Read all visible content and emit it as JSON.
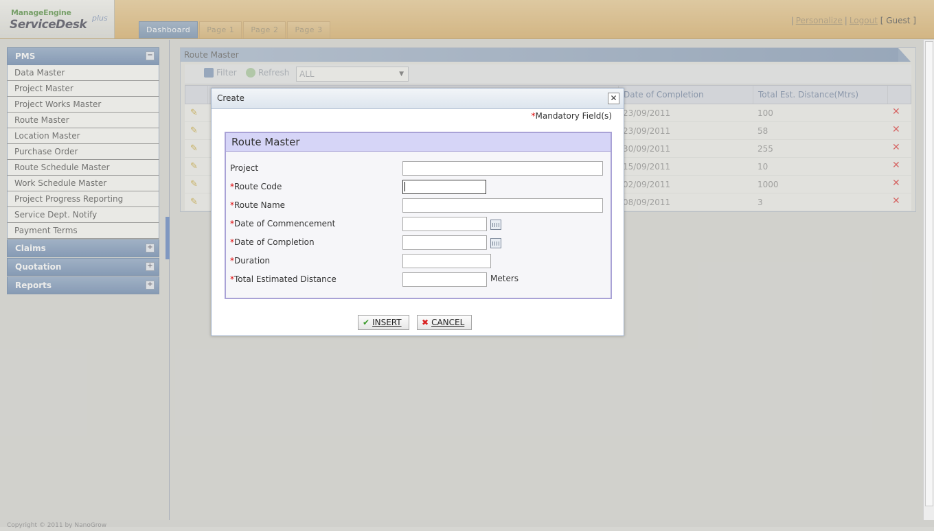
{
  "header": {
    "logo_top": "ManageEngine",
    "logo_main": "ServiceDesk",
    "logo_plus": "plus",
    "tabs": [
      "Dashboard",
      "Page 1",
      "Page 2",
      "Page 3"
    ],
    "personalize": "Personalize",
    "logout": "Logout",
    "user": "[ Guest ]"
  },
  "sidebar": {
    "pms": "PMS",
    "items": [
      "Data Master",
      "Project Master",
      "Project Works Master",
      "Route Master",
      "Location Master",
      "Purchase Order",
      "Route Schedule Master",
      "Work Schedule Master",
      "Project Progress Reporting",
      "Service Dept. Notify",
      "Payment Terms"
    ],
    "claims": "Claims",
    "quotation": "Quotation",
    "reports": "Reports"
  },
  "content": {
    "title": "Route Master",
    "filter": "Filter",
    "refresh": "Refresh",
    "select_value": "ALL",
    "col_completion": "Date of Completion",
    "col_distance": "Total Est. Distance(Mtrs)",
    "rows": [
      {
        "date": "23/09/2011",
        "dist": "100"
      },
      {
        "date": "23/09/2011",
        "dist": "58"
      },
      {
        "date": "30/09/2011",
        "dist": "255"
      },
      {
        "date": "15/09/2011",
        "dist": "10"
      },
      {
        "date": "02/09/2011",
        "dist": "1000"
      },
      {
        "date": "08/09/2011",
        "dist": "3"
      }
    ]
  },
  "modal": {
    "title": "Create",
    "mandatory": "Mandatory Field(s)",
    "form_title": "Route Master",
    "fields": {
      "project": "Project",
      "route_code": "Route Code",
      "route_name": "Route Name",
      "commencement": "Date of Commencement",
      "completion": "Date of Completion",
      "duration": "Duration",
      "distance": "Total Estimated Distance"
    },
    "unit": "Meters",
    "insert": "INSERT",
    "cancel": "CANCEL"
  },
  "footer": "Copyright © 2011 by NanoGrow"
}
